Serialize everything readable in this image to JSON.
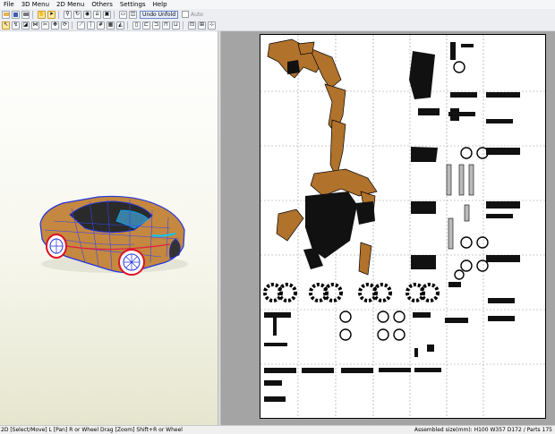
{
  "menu": [
    "File",
    "3D Menu",
    "2D Menu",
    "Others",
    "Settings",
    "Help"
  ],
  "toolbar": {
    "unfold_label": "Undo Unfold",
    "auto_label": "Auto"
  },
  "status": {
    "left": "2D [Select/Move] L [Pan] R or Wheel Drag [Zoom] Shift+R or Wheel",
    "right": "Assembled size(mm): H100 W357 D172 / Parts 175"
  },
  "colors": {
    "part_fill": "#b1722c",
    "dark_fill": "#111111",
    "mesh_blue": "#2233dd",
    "rim_red": "#dd1122"
  }
}
